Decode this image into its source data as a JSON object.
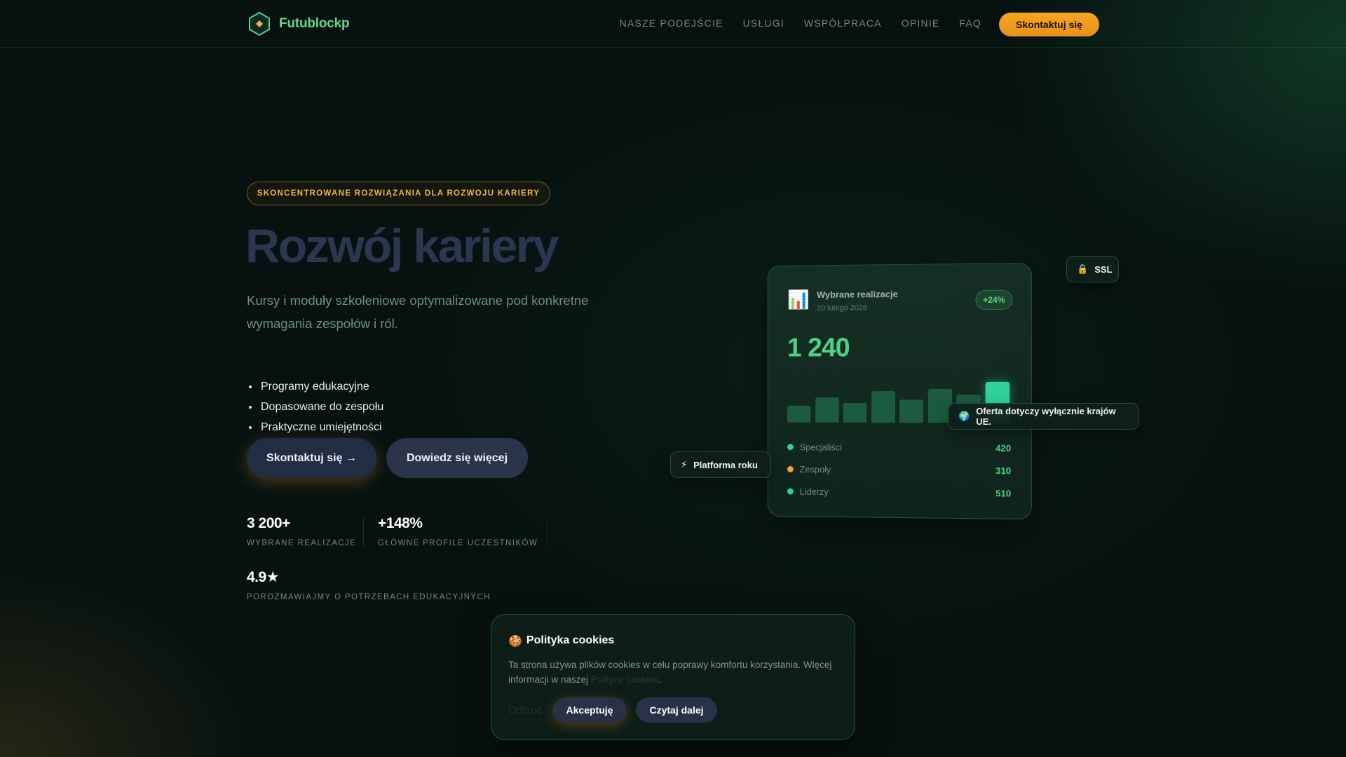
{
  "nav": {
    "logo_text": "Futublockp",
    "links": [
      "NASZE PODEJŚCIE",
      "USŁUGI",
      "WSPÓŁPRACA",
      "OPINIE",
      "FAQ"
    ],
    "cta": "Skontaktuj się"
  },
  "hero": {
    "badge": "SKONCENTROWANE ROZWIĄZANIA DLA ROZWOJU KARIERY",
    "title": "Rozwój kariery",
    "subtitle": "Kursy i moduły szkoleniowe optymalizowane pod konkretne wymagania zespołów i ról.",
    "features": [
      "Programy edukacyjne",
      "Dopasowane do zespołu",
      "Praktyczne umiejętności"
    ],
    "primary_button": "Skontaktuj się →",
    "secondary_button": "Dowiedz się więcej"
  },
  "stats": [
    {
      "value": "3 200+",
      "label": "WYBRANE REALIZACJE"
    },
    {
      "value": "+148%",
      "label": "GŁÓWNE PROFILE UCZESTNIKÓW"
    },
    {
      "value": "4.9★",
      "label": "POROZMAWIAJMY O POTRZEBACH EDUKACYJNYCH"
    }
  ],
  "card": {
    "icon": "📊",
    "icon_name": "bar-chart-icon",
    "title": "Wybrane realizacje",
    "date": "20 lutego 2026",
    "pill": "+24%",
    "big_number": "1 240",
    "bar_levels": [
      0.38,
      0.58,
      0.45,
      0.73,
      0.54,
      0.78,
      0.64,
      0.93
    ],
    "rows": [
      {
        "label": "Specjaliści",
        "value": "420",
        "color": "#2fd29a"
      },
      {
        "label": "Zespoły",
        "value": "310",
        "color": "#f2a623"
      },
      {
        "label": "Liderzy",
        "value": "510",
        "color": "#2fd29a"
      }
    ]
  },
  "tags": {
    "ssl": {
      "icon": "🔒",
      "text": "SSL"
    },
    "eu": {
      "icon": "🌍",
      "text": "Oferta dotyczy wyłącznie krajów UE."
    },
    "platform": {
      "icon": "⚡",
      "text": "Platforma roku"
    }
  },
  "cookies": {
    "icon": "🍪",
    "title": "Polityka cookies",
    "text_before": "Ta strona używa plików cookies w celu poprawy komfortu korzystania. Więcej informacji w naszej ",
    "link": "Polityce cookies",
    "text_after": ".",
    "reject": "Odrzuć",
    "accept": "Akceptuję",
    "more": "Czytaj dalej"
  },
  "colors": {
    "accent_green": "#4ed188",
    "accent_orange": "#f6a623",
    "background": "#071210"
  }
}
